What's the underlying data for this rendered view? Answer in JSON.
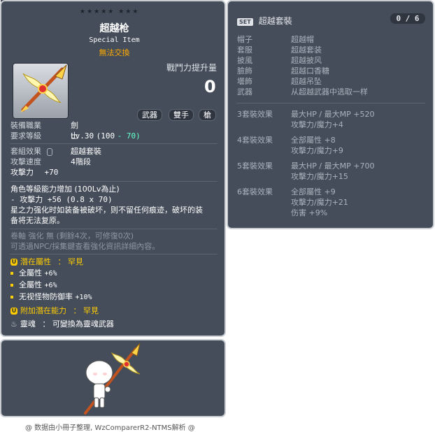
{
  "item_id": "01432223",
  "stars": "★★★★★  ★★★",
  "item": {
    "name": "超越枪",
    "subtitle": "Special Item",
    "tradeable": "無法交換",
    "power_label": "戰鬥力提升量",
    "power_value": "0",
    "tags": [
      "武器",
      "雙手",
      "槍"
    ],
    "job_label": "裝備職業",
    "job_value": "劍士",
    "req_label": "要求等級",
    "req_value": "Lv.30",
    "req_extra_a": "(100",
    "req_extra_b": "- 70)",
    "set_label": "套組效果",
    "set_value": "超越套裝",
    "speed_label": "攻擊速度",
    "speed_value": "4階段",
    "atk_label": "攻擊力",
    "atk_value": "+70",
    "growth_line1": "角色等級能力增加 (100Lv為止)",
    "growth_line2": "- 攻擊力 +56 (0.8 x 70)",
    "desc_line1": "星之力强化时如装备被破坏，则不留任何痕迹，破坏的装",
    "desc_line2": "备将无法复原。",
    "scroll_line": "卷軸 強化 無 (剩餘4次，可修復0次)",
    "enhance_line": "可透過NPC/採集鍵查看強化資訊詳細內容。",
    "potential_label": "潛在屬性",
    "potential_grade": "： 罕見",
    "potentials": [
      {
        "text": "全屬性",
        "value": "+6%"
      },
      {
        "text": "全屬性",
        "value": "+6%"
      },
      {
        "text": "无视怪物防御率",
        "value": "+10%"
      }
    ],
    "additional_label": "附加潛在能力",
    "additional_grade": "： 罕見",
    "soul_label": "靈魂",
    "soul_text": "： 可變換為靈魂武器"
  },
  "set_panel": {
    "badge": "SET",
    "title": "超越套裝",
    "count": "0 / 6",
    "parts": [
      {
        "slot": "帽子",
        "name": "超越帽"
      },
      {
        "slot": "套服",
        "name": "超越套装"
      },
      {
        "slot": "披風",
        "name": "超越披风"
      },
      {
        "slot": "臉飾",
        "name": "超越口香糖"
      },
      {
        "slot": "壜飾",
        "name": "超越吊坠"
      },
      {
        "slot": "武器",
        "name": "从超越武器中选取一样"
      }
    ],
    "effects": [
      {
        "label": "3套裝效果",
        "lines": [
          "最大HP / 最大MP  +520",
          "攻擊力/魔力+4"
        ]
      },
      {
        "label": "4套裝效果",
        "lines": [
          "全部屬性 +8",
          "攻擊力/魔力+9"
        ]
      },
      {
        "label": "5套裝效果",
        "lines": [
          "最大HP / 最大MP  +700",
          "攻擊力/魔力+15"
        ]
      },
      {
        "label": "6套裝效果",
        "lines": [
          "全部屬性 +9",
          "攻擊力/魔力+21",
          "伤害 +9%"
        ]
      }
    ]
  },
  "footer": "@ 数据由小冊子整理, WzComparerR2-NTMS解析 @",
  "colors": {
    "panel": "#444d59",
    "accent_yellow": "#ffcc00",
    "untradeable": "#ffaa00",
    "teal": "#66ffcc"
  }
}
